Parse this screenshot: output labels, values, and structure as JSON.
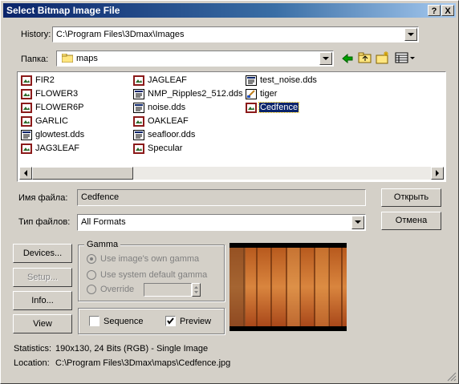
{
  "window": {
    "title": "Select Bitmap Image File",
    "help_btn": "?",
    "close_btn": "X"
  },
  "history": {
    "label": "History:",
    "value": "C:\\Program Files\\3Dmax\\Images"
  },
  "folder": {
    "label": "Папка:",
    "value": "maps"
  },
  "files": [
    {
      "name": "FIR2",
      "icon": "jpeg-file-icon"
    },
    {
      "name": "FLOWER3",
      "icon": "jpeg-file-icon"
    },
    {
      "name": "FLOWER6P",
      "icon": "jpeg-file-icon"
    },
    {
      "name": "GARLIC",
      "icon": "jpeg-file-icon"
    },
    {
      "name": "glowtest.dds",
      "icon": "dds-file-icon"
    },
    {
      "name": "JAG3LEAF",
      "icon": "jpeg-file-icon"
    },
    {
      "name": "JAGLEAF",
      "icon": "jpeg-file-icon"
    },
    {
      "name": "NMP_Ripples2_512.dds",
      "icon": "dds-file-icon"
    },
    {
      "name": "noise.dds",
      "icon": "dds-file-icon"
    },
    {
      "name": "OAKLEAF",
      "icon": "jpeg-file-icon"
    },
    {
      "name": "seafloor.dds",
      "icon": "dds-file-icon"
    },
    {
      "name": "Specular",
      "icon": "jpeg-file-icon"
    },
    {
      "name": "test_noise.dds",
      "icon": "dds-file-icon"
    },
    {
      "name": "tiger",
      "icon": "image-file-icon"
    },
    {
      "name": "Cedfence",
      "icon": "jpeg-file-icon",
      "selected": true
    }
  ],
  "filename": {
    "label": "Имя файла:",
    "value": "Cedfence"
  },
  "filetype": {
    "label": "Тип файлов:",
    "value": "All Formats"
  },
  "buttons": {
    "open": "Открыть",
    "cancel": "Отмена",
    "devices": "Devices...",
    "setup": "Setup...",
    "info": "Info...",
    "view": "View"
  },
  "gamma": {
    "title": "Gamma",
    "use_image": "Use image's own gamma",
    "use_system": "Use system default gamma",
    "override": "Override"
  },
  "options": {
    "sequence": "Sequence",
    "preview": "Preview",
    "sequence_checked": false,
    "preview_checked": true
  },
  "statistics": {
    "label": "Statistics:",
    "value": "190x130, 24 Bits (RGB) - Single Image"
  },
  "location": {
    "label": "Location:",
    "value": "C:\\Program Files\\3Dmax\\maps\\Cedfence.jpg"
  },
  "colors": {
    "title_start": "#0a246a",
    "title_end": "#a6caf0",
    "selection": "#0a246a",
    "face": "#d4d0c8"
  }
}
